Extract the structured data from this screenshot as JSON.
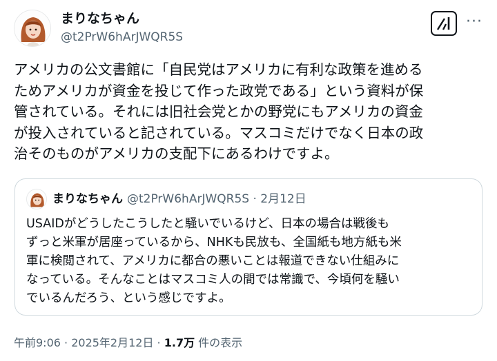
{
  "author": {
    "display_name": "まりなちゃん",
    "handle": "@t2PrW6hArJWQR5S"
  },
  "tweet": {
    "text": "アメリカの公文書館に「自民党はアメリカに有利な政策を進める\nためアメリカが資金を投じて作った政党である」という資料が保\n管されている。それには旧社会党とかの野党にもアメリカの資金\nが投入されていると記されている。マスコミだけでなく日本の政\n治そのものがアメリカの支配下にあるわけですよ。"
  },
  "quote": {
    "display_name": "まりなちゃん",
    "handle_date": "@t2PrW6hArJWQR5S · 2月12日",
    "text": "USAIDがどうしたこうしたと騒いでいるけど、日本の場合は戦後も\nずっと米軍が居座っているから、NHKも民放も、全国紙も地方紙も米\n軍に検閲されて、アメリカに都合の悪いことは報道できない仕組みに\nなっている。そんなことはマスコミ人の間では常識で、今頃何を騒い\nでいるんだろう、という感じですよ。"
  },
  "footer": {
    "time": "午前9:06",
    "sep1": " · ",
    "date": "2025年2月12日",
    "sep2": " · ",
    "views": "1.7万",
    "views_label": " 件の表示"
  },
  "icons": {
    "grok": "grok-icon",
    "more": "more-options-icon"
  },
  "colors": {
    "text": "#0f1419",
    "secondary": "#536471",
    "border": "#cfd9de"
  }
}
